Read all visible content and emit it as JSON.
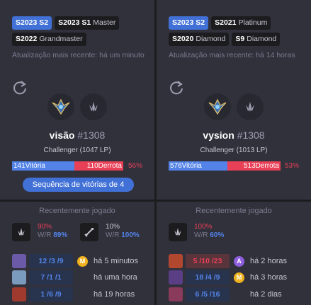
{
  "colors": {
    "win": "#5383e8",
    "loss": "#e84057",
    "active_tag": "#4171d6"
  },
  "players": [
    {
      "tags": [
        {
          "season": "S2023 S2",
          "tier": "",
          "active": true
        },
        {
          "season": "S2023 S1",
          "tier": "Master",
          "active": false
        },
        {
          "season": "S2022",
          "tier": "Grandmaster",
          "active": false
        }
      ],
      "updated": "Atualização mais recente: há um minuto",
      "refresh_icon": "refresh-icon",
      "name": "visão",
      "tagline": "#1308",
      "tier": "Challenger (1047 LP)",
      "wins_label": "141Vitória",
      "losses_label": "110Derrota",
      "win_fraction": 0.562,
      "winrate": "56%",
      "streak": "Sequência de vitórias de 4",
      "recent_title": "Recentemente jogado",
      "champions": [
        {
          "pct": "90%",
          "wr_prefix": "W/R",
          "wr": "89%",
          "icon": "challenger-emblem-icon",
          "gray": false
        },
        {
          "pct": "10%",
          "wr_prefix": "W/R",
          "wr": "100%",
          "icon": "sword-icon",
          "gray": true
        }
      ],
      "matches": [
        {
          "kda": "12 /3 /9",
          "result": "win",
          "badge": "M",
          "badge_color": "#f0b31e",
          "ago": "há 5 minutos",
          "avatar_color": "#6b5aa8"
        },
        {
          "kda": "7 /1 /1",
          "result": "win",
          "badge": "",
          "badge_color": "",
          "ago": "há uma hora",
          "avatar_color": "#7a9bbd"
        },
        {
          "kda": "1 /6 /9",
          "result": "win",
          "badge": "",
          "badge_color": "",
          "ago": "há 19 horas",
          "avatar_color": "#a03a2e"
        }
      ]
    },
    {
      "tags": [
        {
          "season": "S2023 S2",
          "tier": "",
          "active": true
        },
        {
          "season": "S2021",
          "tier": "Platinum",
          "active": false
        },
        {
          "season": "S2020",
          "tier": "Diamond",
          "active": false
        },
        {
          "season": "S9",
          "tier": "Diamond",
          "active": false
        }
      ],
      "updated": "Atualização mais recente: há 14 horas",
      "refresh_icon": "refresh-icon",
      "name": "vysion",
      "tagline": "#1308",
      "tier": "Challenger (1013 LP)",
      "wins_label": "576Vitória",
      "losses_label": "513Derrota",
      "win_fraction": 0.529,
      "winrate": "53%",
      "recent_title": "Recentemente jogado",
      "champions": [
        {
          "pct": "100%",
          "wr_prefix": "W/R",
          "wr": "60%",
          "icon": "challenger-emblem-icon",
          "gray": false
        }
      ],
      "matches": [
        {
          "kda": "5 /10 /23",
          "result": "loss",
          "badge": "A",
          "badge_color": "#8f5fe0",
          "ago": "há 2 horas",
          "avatar_color": "#b0472e"
        },
        {
          "kda": "18 /4 /9",
          "result": "win",
          "badge": "M",
          "badge_color": "#f0b31e",
          "ago": "há 3 horas",
          "avatar_color": "#5a3f86"
        },
        {
          "kda": "6 /5 /16",
          "result": "win",
          "badge": "",
          "badge_color": "",
          "ago": "há 2 dias",
          "avatar_color": "#8a3a5b"
        }
      ]
    }
  ]
}
